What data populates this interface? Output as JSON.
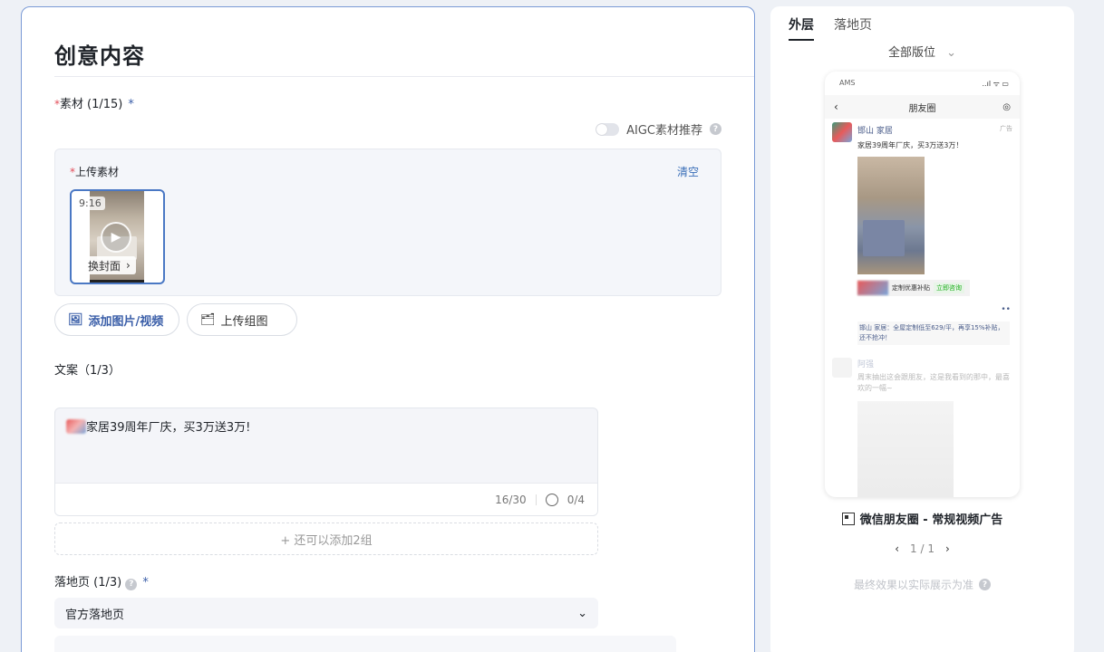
{
  "main": {
    "title": "创意内容",
    "material": {
      "required_mark": "*",
      "label": "素材",
      "count": "(1/15)",
      "star": "*"
    },
    "aigc": {
      "label": "AIGC素材推荐",
      "help": "?"
    },
    "upload": {
      "required_mark": "*",
      "label": "上传素材",
      "clear": "清空",
      "thumb": {
        "ratio": "9:16",
        "cover_label": "换封面",
        "cover_arrow": "›"
      }
    },
    "buttons": {
      "add_media": "添加图片/视频",
      "upload_group": "上传组图"
    },
    "copy": {
      "label": "文案（1/3）",
      "text": "家居39周年厂庆，买3万送3万!",
      "char_count": "16/30",
      "emoji_count": "0/4",
      "add_more": "+ 还可以添加2组"
    },
    "landing": {
      "label": "落地页 (1/3)",
      "help": "?",
      "star": "*",
      "selected": "官方落地页",
      "chevron": "⌄"
    }
  },
  "preview": {
    "tabs": [
      "外层",
      "落地页"
    ],
    "active_tab": 0,
    "placement": "全部版位",
    "placement_chevron": "⌄",
    "phone": {
      "carrier": "AMS",
      "signal": "..ıl ᯤ ▭",
      "nav_title": "朋友圈",
      "back": "‹",
      "camera": "◎",
      "post_name": "邯山    家居",
      "ad_tag": "广告",
      "post_text": "家居39周年厂庆，买3万送3万！",
      "link_text": "定制优惠补贴",
      "link_cta": "立即咨询",
      "dots": "••",
      "comment": "邯山    家居：全屋定制低至629/平，再享15%补贴，还不抢冲！",
      "post2_name": "阿强",
      "post2_text": "周末抽出这会跟朋友，这是我看到的那中，最喜欢的一幅~"
    },
    "ad_type": "微信朋友圈 - 常规视频广告",
    "pager": {
      "prev": "‹",
      "page": "1 / 1",
      "next": "›"
    },
    "final_note": "最终效果以实际展示为准",
    "final_help": "?"
  },
  "colors": {
    "accent_border": "#7a9ad6",
    "link_blue": "#3a6fb8",
    "required_red": "#e34d59"
  }
}
